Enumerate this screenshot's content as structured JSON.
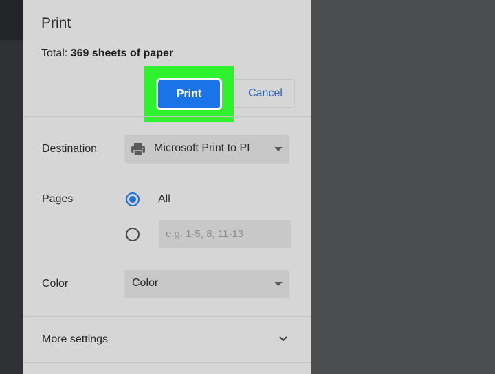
{
  "dialog": {
    "title": "Print",
    "total_prefix": "Total: ",
    "total_value": "369 sheets of paper"
  },
  "actions": {
    "print_label": "Print",
    "cancel_label": "Cancel"
  },
  "destination": {
    "label": "Destination",
    "selected": "Microsoft Print to PI",
    "icon": "printer-icon"
  },
  "pages": {
    "label": "Pages",
    "all_label": "All",
    "all_selected": true,
    "custom_placeholder": "e.g. 1-5, 8, 11-13",
    "custom_value": ""
  },
  "color": {
    "label": "Color",
    "selected": "Color"
  },
  "more_settings": {
    "label": "More settings",
    "icon": "chevron-down-icon"
  },
  "colors": {
    "print_button": "#1b73e8",
    "highlight": "#2ef22e",
    "radio_accent": "#1b6fe0",
    "cancel_text": "#2a62c4"
  }
}
